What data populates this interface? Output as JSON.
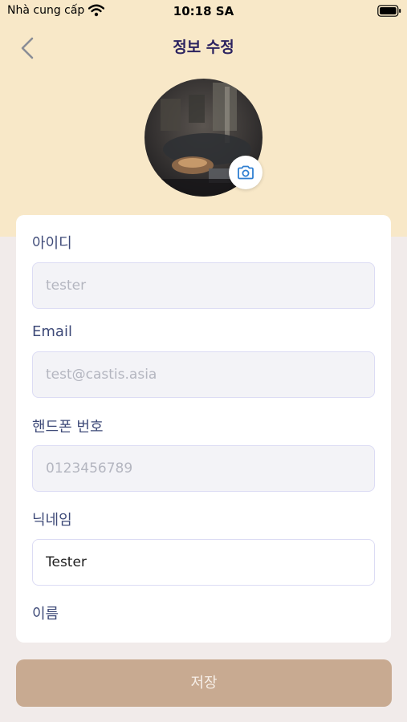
{
  "status_bar": {
    "carrier": "Nhà cung cấp",
    "time": "10:18 SA"
  },
  "nav": {
    "title": "정보 수정",
    "back_icon": "chevron-left-icon"
  },
  "profile": {
    "camera_icon": "camera-icon"
  },
  "form": {
    "fields": [
      {
        "label": "아이디",
        "value": "tester",
        "editable": false
      },
      {
        "label": "Email",
        "value": "test@castis.asia",
        "editable": false
      },
      {
        "label": "핸드폰 번호",
        "value": "0123456789",
        "editable": false
      },
      {
        "label": "닉네임",
        "value": "Tester",
        "editable": true
      },
      {
        "label": "이름"
      }
    ]
  },
  "save_button_label": "저장",
  "colors": {
    "header_bg": "#f8e8c8",
    "page_bg": "#f1ebea",
    "title": "#2c2360",
    "label": "#3e4a78",
    "save_button": "#c8aa91"
  }
}
